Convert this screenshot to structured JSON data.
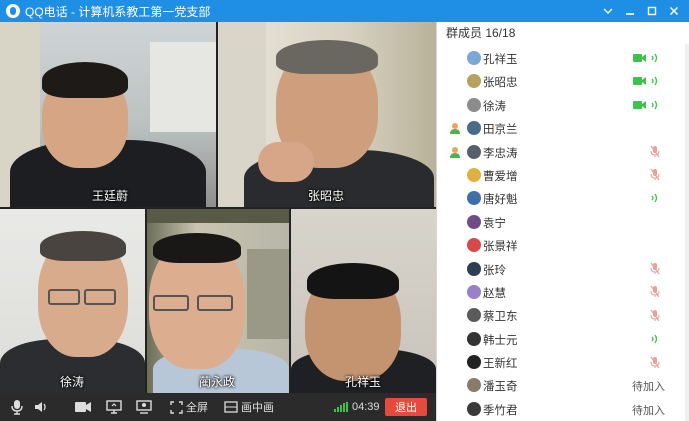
{
  "window": {
    "title": "QQ电话 - 计算机系教工第一党支部"
  },
  "video_tiles": [
    {
      "name": "王廷蔚"
    },
    {
      "name": "张昭忠"
    },
    {
      "name": "徐涛"
    },
    {
      "name": "蔺永政"
    },
    {
      "name": "孔祥玉"
    }
  ],
  "toolbar": {
    "fullscreen_label": "全屏",
    "pip_label": "画中画",
    "timer": "04:39",
    "exit_label": "退出"
  },
  "panel": {
    "header": "群成员 16/18",
    "members": [
      {
        "name": "孔祥玉",
        "admin": false,
        "status": "video",
        "avatar_color": "#7aa7d6"
      },
      {
        "name": "张昭忠",
        "admin": false,
        "status": "video",
        "avatar_color": "#b8a060"
      },
      {
        "name": "徐涛",
        "admin": false,
        "status": "video",
        "avatar_color": "#8c8c8c"
      },
      {
        "name": "田京兰",
        "admin": true,
        "status": "none",
        "avatar_color": "#4a6b8a"
      },
      {
        "name": "李忠涛",
        "admin": true,
        "status": "muted",
        "avatar_color": "#55606a"
      },
      {
        "name": "曹爱增",
        "admin": false,
        "status": "muted",
        "avatar_color": "#e0b040"
      },
      {
        "name": "唐好魁",
        "admin": false,
        "status": "speaking",
        "avatar_color": "#3f6fa8"
      },
      {
        "name": "袁宁",
        "admin": false,
        "status": "none",
        "avatar_color": "#6f4b8a"
      },
      {
        "name": "张景祥",
        "admin": false,
        "status": "none",
        "avatar_color": "#d94848"
      },
      {
        "name": "张玲",
        "admin": false,
        "status": "muted",
        "avatar_color": "#2c3e50"
      },
      {
        "name": "赵慧",
        "admin": false,
        "status": "muted",
        "avatar_color": "#9b7fc7"
      },
      {
        "name": "蔡卫东",
        "admin": false,
        "status": "muted",
        "avatar_color": "#5a5a5a"
      },
      {
        "name": "韩士元",
        "admin": false,
        "status": "speaking",
        "avatar_color": "#333333"
      },
      {
        "name": "王新红",
        "admin": false,
        "status": "muted",
        "avatar_color": "#222222"
      },
      {
        "name": "潘玉奇",
        "admin": false,
        "status": "pending",
        "pending_label": "待加入",
        "avatar_color": "#8a7a6a"
      },
      {
        "name": "季竹君",
        "admin": false,
        "status": "pending",
        "pending_label": "待加入",
        "avatar_color": "#3a3a3a"
      }
    ]
  },
  "colors": {
    "titlebar": "#1f8fe6",
    "exit": "#e64a3c",
    "active_green": "#3fc24a",
    "muted_red": "#e8a0a0"
  },
  "icons": {
    "mic": "microphone-icon",
    "speaker": "speaker-icon",
    "camera": "camera-icon",
    "share": "screen-share-icon",
    "presenter": "presenter-icon",
    "fullscreen": "fullscreen-icon",
    "pip": "picture-in-picture-icon"
  }
}
